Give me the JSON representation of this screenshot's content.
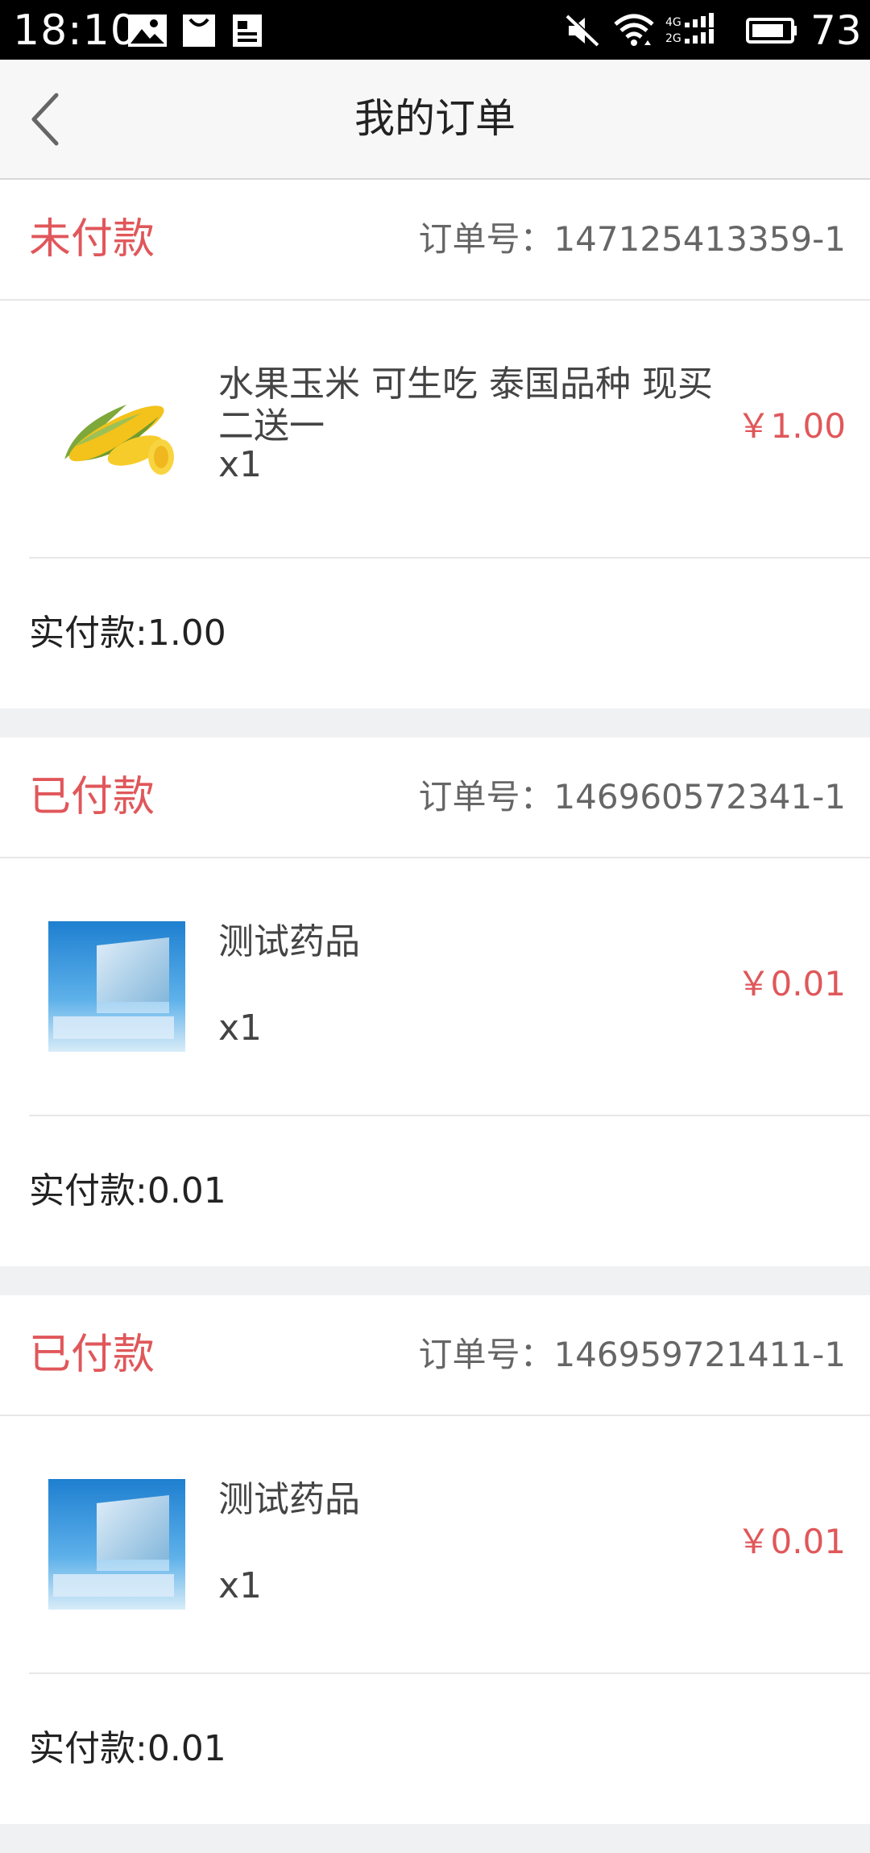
{
  "status_bar": {
    "time": "18:10",
    "battery": "73",
    "icons": [
      "gallery-icon",
      "bag-icon",
      "document-icon",
      "mute-icon",
      "wifi-icon",
      "signal-icon",
      "battery-icon"
    ]
  },
  "header": {
    "title": "我的订单",
    "back_icon": "chevron-left-icon"
  },
  "colors": {
    "status_red": "#e0575a",
    "page_bg": "#f0f1f3",
    "header_bg": "#f7f7f7"
  },
  "orders": [
    {
      "status": "未付款",
      "order_no": "订单号：147125413359-1",
      "item": {
        "image": "corn-image",
        "name": "水果玉米 可生吃 泰国品种 现买二送一",
        "qty": "x1",
        "price": "￥1.00"
      },
      "paid": "实付款:1.00"
    },
    {
      "status": "已付款",
      "order_no": "订单号：146960572341-1",
      "item": {
        "image": "slideshow-image",
        "name": "测试药品",
        "qty": "x1",
        "price": "￥0.01"
      },
      "paid": "实付款:0.01"
    },
    {
      "status": "已付款",
      "order_no": "订单号：146959721411-1",
      "item": {
        "image": "slideshow-image",
        "name": "测试药品",
        "qty": "x1",
        "price": "￥0.01"
      },
      "paid": "实付款:0.01"
    }
  ]
}
